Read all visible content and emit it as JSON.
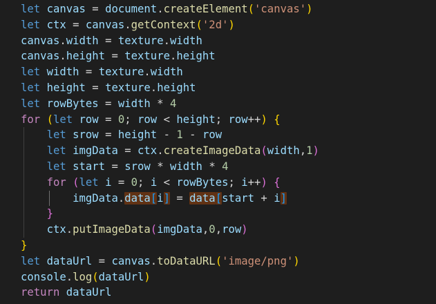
{
  "editor": {
    "background": "#1e1e1e",
    "lines": [
      [
        [
          "kw",
          "let"
        ],
        [
          "op",
          " "
        ],
        [
          "var",
          "canvas"
        ],
        [
          "op",
          " = "
        ],
        [
          "var",
          "document"
        ],
        [
          "op",
          "."
        ],
        [
          "fn",
          "createElement"
        ],
        [
          "b1",
          "("
        ],
        [
          "str",
          "'canvas'"
        ],
        [
          "b1",
          ")"
        ]
      ],
      [
        [
          "kw",
          "let"
        ],
        [
          "op",
          " "
        ],
        [
          "var",
          "ctx"
        ],
        [
          "op",
          " = "
        ],
        [
          "var",
          "canvas"
        ],
        [
          "op",
          "."
        ],
        [
          "fn",
          "getContext"
        ],
        [
          "b1",
          "("
        ],
        [
          "str",
          "'2d'"
        ],
        [
          "b1",
          ")"
        ]
      ],
      [
        [
          "var",
          "canvas"
        ],
        [
          "op",
          "."
        ],
        [
          "var",
          "width"
        ],
        [
          "op",
          " = "
        ],
        [
          "var",
          "texture"
        ],
        [
          "op",
          "."
        ],
        [
          "var",
          "width"
        ]
      ],
      [
        [
          "var",
          "canvas"
        ],
        [
          "op",
          "."
        ],
        [
          "var",
          "height"
        ],
        [
          "op",
          " = "
        ],
        [
          "var",
          "texture"
        ],
        [
          "op",
          "."
        ],
        [
          "var",
          "height"
        ]
      ],
      [
        [
          "kw",
          "let"
        ],
        [
          "op",
          " "
        ],
        [
          "var",
          "width"
        ],
        [
          "op",
          " = "
        ],
        [
          "var",
          "texture"
        ],
        [
          "op",
          "."
        ],
        [
          "var",
          "width"
        ]
      ],
      [
        [
          "kw",
          "let"
        ],
        [
          "op",
          " "
        ],
        [
          "var",
          "height"
        ],
        [
          "op",
          " = "
        ],
        [
          "var",
          "texture"
        ],
        [
          "op",
          "."
        ],
        [
          "var",
          "height"
        ]
      ],
      [
        [
          "kw",
          "let"
        ],
        [
          "op",
          " "
        ],
        [
          "var",
          "rowBytes"
        ],
        [
          "op",
          " = "
        ],
        [
          "var",
          "width"
        ],
        [
          "op",
          " * "
        ],
        [
          "num",
          "4"
        ]
      ],
      [
        [
          "ctl",
          "for"
        ],
        [
          "op",
          " "
        ],
        [
          "b1",
          "("
        ],
        [
          "kw",
          "let"
        ],
        [
          "op",
          " "
        ],
        [
          "var",
          "row"
        ],
        [
          "op",
          " = "
        ],
        [
          "num",
          "0"
        ],
        [
          "op",
          "; "
        ],
        [
          "var",
          "row"
        ],
        [
          "op",
          " < "
        ],
        [
          "var",
          "height"
        ],
        [
          "op",
          "; "
        ],
        [
          "var",
          "row"
        ],
        [
          "op",
          "++"
        ],
        [
          "b1",
          ")"
        ],
        [
          "op",
          " "
        ],
        [
          "b1",
          "{"
        ]
      ],
      [
        [
          "op",
          "    "
        ],
        [
          "kw",
          "let"
        ],
        [
          "op",
          " "
        ],
        [
          "var",
          "srow"
        ],
        [
          "op",
          " = "
        ],
        [
          "var",
          "height"
        ],
        [
          "op",
          " - "
        ],
        [
          "num",
          "1"
        ],
        [
          "op",
          " - "
        ],
        [
          "var",
          "row"
        ]
      ],
      [
        [
          "op",
          "    "
        ],
        [
          "kw",
          "let"
        ],
        [
          "op",
          " "
        ],
        [
          "var",
          "imgData"
        ],
        [
          "op",
          " = "
        ],
        [
          "var",
          "ctx"
        ],
        [
          "op",
          "."
        ],
        [
          "fn",
          "createImageData"
        ],
        [
          "b2",
          "("
        ],
        [
          "var",
          "width"
        ],
        [
          "op",
          ","
        ],
        [
          "num",
          "1"
        ],
        [
          "b2",
          ")"
        ]
      ],
      [
        [
          "op",
          "    "
        ],
        [
          "kw",
          "let"
        ],
        [
          "op",
          " "
        ],
        [
          "var",
          "start"
        ],
        [
          "op",
          " = "
        ],
        [
          "var",
          "srow"
        ],
        [
          "op",
          " * "
        ],
        [
          "var",
          "width"
        ],
        [
          "op",
          " * "
        ],
        [
          "num",
          "4"
        ]
      ],
      [
        [
          "op",
          "    "
        ],
        [
          "ctl",
          "for"
        ],
        [
          "op",
          " "
        ],
        [
          "b2",
          "("
        ],
        [
          "kw",
          "let"
        ],
        [
          "op",
          " "
        ],
        [
          "var",
          "i"
        ],
        [
          "op",
          " = "
        ],
        [
          "num",
          "0"
        ],
        [
          "op",
          "; "
        ],
        [
          "var",
          "i"
        ],
        [
          "op",
          " < "
        ],
        [
          "var",
          "rowBytes"
        ],
        [
          "op",
          "; "
        ],
        [
          "var",
          "i"
        ],
        [
          "op",
          "++"
        ],
        [
          "b2",
          ")"
        ],
        [
          "op",
          " "
        ],
        [
          "b2",
          "{"
        ]
      ],
      [
        [
          "op",
          "        "
        ],
        [
          "var",
          "imgData"
        ],
        [
          "op",
          "."
        ],
        [
          "varhl",
          "data"
        ],
        [
          "b3hl",
          "["
        ],
        [
          "var",
          "i"
        ],
        [
          "b3hl",
          "]"
        ],
        [
          "op",
          " = "
        ],
        [
          "varhl",
          "data"
        ],
        [
          "b3hl",
          "["
        ],
        [
          "var",
          "start"
        ],
        [
          "op",
          " + "
        ],
        [
          "var",
          "i"
        ],
        [
          "b3hl",
          "]"
        ]
      ],
      [
        [
          "op",
          "    "
        ],
        [
          "b2",
          "}"
        ]
      ],
      [
        [
          "op",
          "    "
        ],
        [
          "var",
          "ctx"
        ],
        [
          "op",
          "."
        ],
        [
          "fn",
          "putImageData"
        ],
        [
          "b2",
          "("
        ],
        [
          "var",
          "imgData"
        ],
        [
          "op",
          ","
        ],
        [
          "num",
          "0"
        ],
        [
          "op",
          ","
        ],
        [
          "var",
          "row"
        ],
        [
          "b2",
          ")"
        ]
      ],
      [
        [
          "b1",
          "}"
        ]
      ],
      [
        [
          "kw",
          "let"
        ],
        [
          "op",
          " "
        ],
        [
          "var",
          "dataUrl"
        ],
        [
          "op",
          " = "
        ],
        [
          "var",
          "canvas"
        ],
        [
          "op",
          "."
        ],
        [
          "fn",
          "toDataURL"
        ],
        [
          "b1",
          "("
        ],
        [
          "str",
          "'image/png'"
        ],
        [
          "b1",
          ")"
        ]
      ],
      [
        [
          "var",
          "console"
        ],
        [
          "op",
          "."
        ],
        [
          "fn",
          "log"
        ],
        [
          "b1",
          "("
        ],
        [
          "var",
          "dataUrl"
        ],
        [
          "b1",
          ")"
        ]
      ],
      [
        [
          "ctl",
          "return"
        ],
        [
          "op",
          " "
        ],
        [
          "var",
          "dataUrl"
        ]
      ]
    ]
  }
}
